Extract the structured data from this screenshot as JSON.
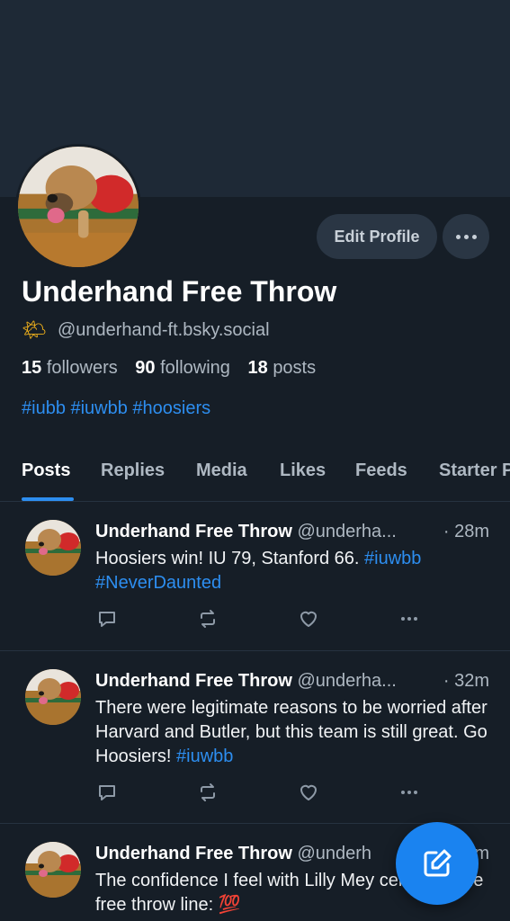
{
  "profile": {
    "display_name": "Underhand Free Throw",
    "handle_emoji": "🌤",
    "handle": "@underhand-ft.bsky.social",
    "followers_count": "15",
    "followers_label": "followers",
    "following_count": "90",
    "following_label": "following",
    "posts_count": "18",
    "posts_label": "posts",
    "bio": "#iubb #iuwbb #hoosiers",
    "edit_label": "Edit Profile"
  },
  "tabs": [
    {
      "label": "Posts",
      "active": true
    },
    {
      "label": "Replies"
    },
    {
      "label": "Media"
    },
    {
      "label": "Likes"
    },
    {
      "label": "Feeds"
    },
    {
      "label": "Starter Packs"
    }
  ],
  "posts": [
    {
      "name": "Underhand Free Throw",
      "handle": "@underha...",
      "time": "· 28m",
      "text_before": "Hoosiers win! IU 79, Stanford 66. ",
      "tags": "#iuwbb #NeverDaunted",
      "text_after": ""
    },
    {
      "name": "Underhand Free Throw",
      "handle": "@underha...",
      "time": "· 32m",
      "text_before": "There were legitimate reasons to be worried after Harvard and Butler, but this team is still great. Go Hoosiers! ",
      "tags": "#iuwbb",
      "text_after": ""
    },
    {
      "name": "Underhand Free Throw",
      "handle": "@underh",
      "time": "m",
      "text_before": "The confidence I feel with Lilly Me",
      "tags": "",
      "text_after": "y center, at the free throw line: 💯"
    }
  ],
  "icons": {
    "reply": "reply-icon",
    "repost": "repost-icon",
    "like": "heart-icon",
    "more": "more-icon",
    "compose": "compose-icon"
  },
  "colors": {
    "background": "#161e27",
    "banner": "#1e2936",
    "accent": "#2d8ef0",
    "fab": "#1a83f0"
  }
}
